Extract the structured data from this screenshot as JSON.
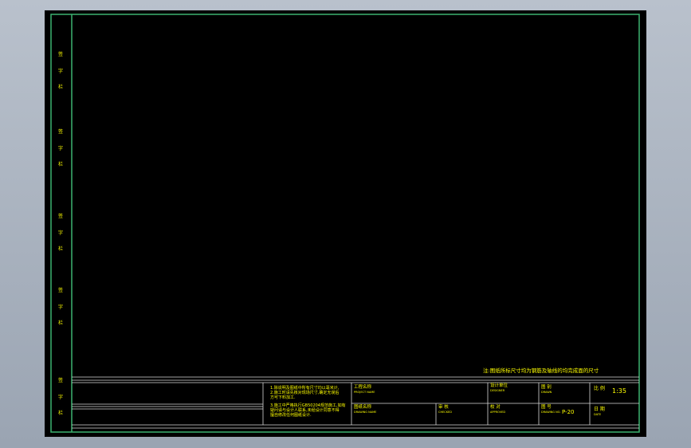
{
  "colors": {
    "frame": "#3cb371",
    "rule": "#d8d8d8",
    "text": "#ffff00",
    "sheet": "#000000",
    "backdrop": "#a7b0bd"
  },
  "margin_labels": {
    "group1": [
      "签",
      "字",
      "栏"
    ],
    "group2": [
      "签",
      "字",
      "栏"
    ],
    "group3": [
      "签",
      "字",
      "栏"
    ],
    "group4": [
      "签",
      "字",
      "栏"
    ],
    "group5": [
      "签",
      "字",
      "栏"
    ]
  },
  "note_line": "注:图纸所标尺寸均为钢筋及轴线的均完成面的尺寸",
  "title_block": {
    "notes": [
      "1.除说明及图纸中所有尺寸均以毫米计,",
      "2.施工时请先核对现场尺寸,确定无误后",
      "方可下料加工.",
      "3.施工中严格执行GB50204规范施工,如有",
      "疑问请与设计人联系,未经设计同意不得",
      "擅自修改任何图纸设计."
    ],
    "project_label": "工程名称",
    "project_sub": "PROJECT NAME",
    "drawing_label": "图纸名称",
    "drawing_sub": "DRAWING NAME",
    "design_label": "设计单位",
    "design_sub": "DESIGNER",
    "drawn_label": "图 别",
    "drawn_sub": "DRAWN",
    "scale_label": "比 例",
    "scale_value": "1:35",
    "check_label": "审 核",
    "check_sub": "CHECKED",
    "approve_label": "校 对",
    "approve_sub": "APPROVED",
    "number_label": "图 号",
    "number_sub": "DRAWING NO.",
    "number_value": "P-20",
    "date_label": "日 期",
    "date_sub": "DATE"
  }
}
